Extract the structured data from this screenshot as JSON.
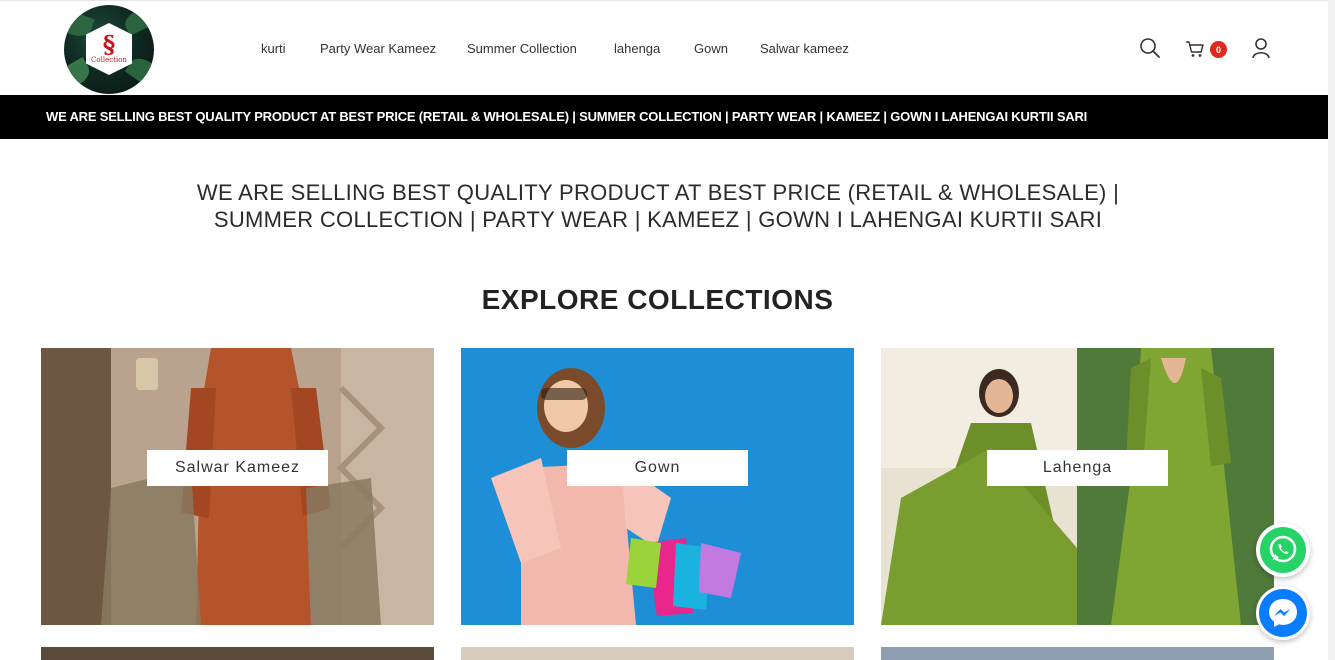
{
  "brand": {
    "logo_mark": "§",
    "logo_text": "Collection"
  },
  "nav": {
    "items": [
      "kurti",
      "Party Wear Kameez",
      "Summer Collection",
      "lahenga",
      "Gown",
      "Salwar kameez"
    ]
  },
  "header_icons": {
    "search": "search-icon",
    "cart": "cart-icon",
    "cart_count": "0",
    "account": "user-icon"
  },
  "announcement": {
    "text": "WE ARE SELLING BEST QUALITY PRODUCT AT BEST PRICE (RETAIL & WHOLESALE) | SUMMER COLLECTION | PARTY WEAR | KAMEEZ | GOWN I LAHENGAI KURTII SARI"
  },
  "intro": {
    "text": "WE ARE SELLING BEST QUALITY PRODUCT AT BEST PRICE (RETAIL & WHOLESALE) | SUMMER COLLECTION | PARTY WEAR | KAMEEZ | GOWN I LAHENGAI KURTII SARI"
  },
  "collections": {
    "title": "EXPLORE COLLECTIONS",
    "items": [
      {
        "label": "Salwar Kameez"
      },
      {
        "label": "Gown"
      },
      {
        "label": "Lahenga"
      }
    ]
  },
  "floating": {
    "whatsapp": "whatsapp-icon",
    "messenger": "messenger-icon"
  },
  "colors": {
    "announcement_bg": "#000000",
    "cart_badge": "#e0281b",
    "whatsapp": "#25d366",
    "messenger": "#0a7cff"
  }
}
